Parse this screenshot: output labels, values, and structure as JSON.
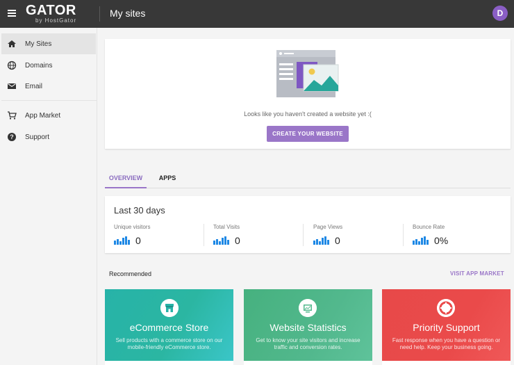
{
  "header": {
    "logo_main": "GATOR",
    "logo_sub": "by HostGator",
    "page_title": "My sites",
    "avatar_initial": "D"
  },
  "sidebar": {
    "items": [
      {
        "label": "My Sites",
        "icon": "home-icon",
        "active": true
      },
      {
        "label": "Domains",
        "icon": "globe-icon",
        "active": false
      },
      {
        "label": "Email",
        "icon": "mail-icon",
        "active": false
      },
      {
        "label": "App Market",
        "icon": "cart-icon",
        "active": false
      },
      {
        "label": "Support",
        "icon": "help-icon",
        "active": false
      }
    ]
  },
  "hero": {
    "message": "Looks like you haven't created a website yet :(",
    "button_label": "CREATE YOUR WEBSITE"
  },
  "tabs": [
    {
      "label": "OVERVIEW",
      "active": true
    },
    {
      "label": "APPS",
      "active": false
    }
  ],
  "stats": {
    "title": "Last 30 days",
    "items": [
      {
        "label": "Unique visitors",
        "value": "0"
      },
      {
        "label": "Total Visits",
        "value": "0"
      },
      {
        "label": "Page Views",
        "value": "0"
      },
      {
        "label": "Bounce Rate",
        "value": "0%"
      }
    ]
  },
  "recommended": {
    "title": "Recommended",
    "link_label": "VISIT APP MARKET",
    "apps": [
      {
        "name": "eCommerce Store",
        "description": "Sell products with a commerce store on our mobile-friendly eCommerce store.",
        "icon": "store-icon"
      },
      {
        "name": "Website Statistics",
        "description": "Get to know your site visitors and increase traffic and conversion rates.",
        "icon": "stats-icon"
      },
      {
        "name": "Priority Support",
        "description": "Fast response when you have a question or need help. Keep your business going.",
        "icon": "lifebuoy-icon"
      }
    ]
  },
  "colors": {
    "topbar": "#383838",
    "accent": "#9a76c8",
    "chart_blue": "#1e88e5",
    "ecommerce": "#27b3a8",
    "statistics": "#52b88d",
    "support": "#ea4a4a"
  }
}
